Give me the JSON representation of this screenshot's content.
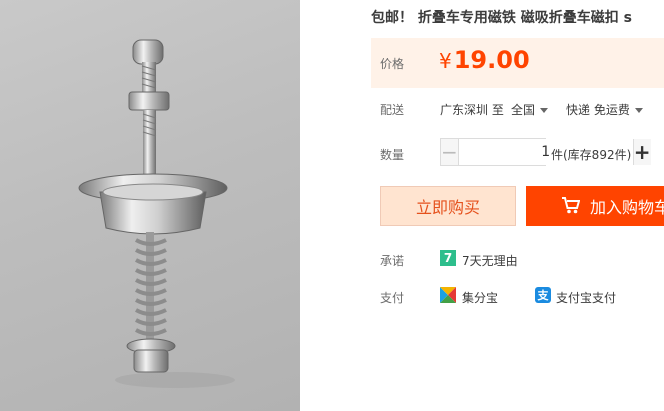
{
  "product": {
    "title": "包邮！ 折叠车专用磁铁 磁吸折叠车磁扣 s"
  },
  "price": {
    "label": "价格",
    "currency_symbol": "¥",
    "value": "19.00",
    "color": "#ff4400"
  },
  "shipping": {
    "label": "配送",
    "from": "广东深圳 至",
    "to": "全国",
    "method": "快递 免运费"
  },
  "quantity": {
    "label": "数量",
    "minus": "−",
    "value": "1",
    "plus": "+",
    "stock": "件(库存892件)"
  },
  "actions": {
    "buy_now": "立即购买",
    "add_to_cart": "加入购物车"
  },
  "promise": {
    "label": "承诺",
    "icon_text": "7",
    "text": "7天无理由"
  },
  "payment": {
    "label": "支付",
    "method1": "集分宝",
    "method2_icon": "支",
    "method2": "支付宝支付"
  }
}
